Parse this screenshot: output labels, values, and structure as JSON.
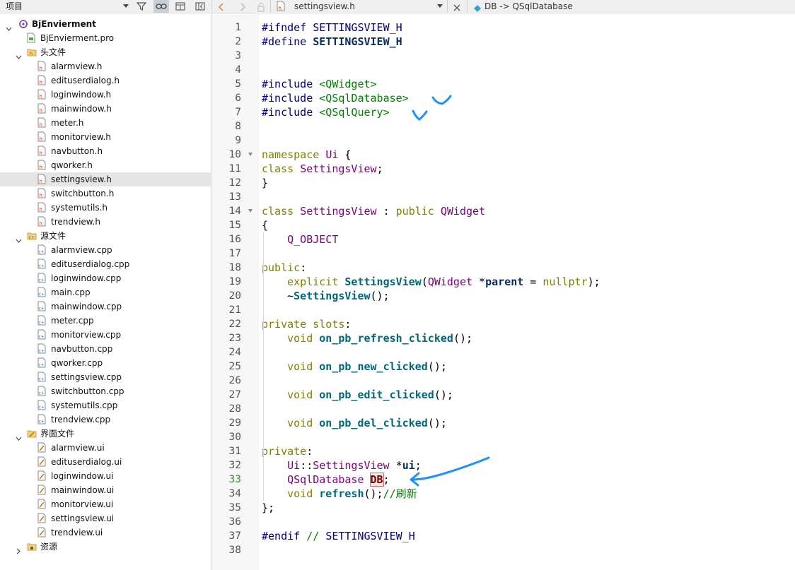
{
  "left_panel": {
    "title": "项目",
    "tree": [
      {
        "label": "BjEnvierment",
        "depth": 0,
        "expanded": true,
        "icon": "qt-project-icon",
        "bold": true
      },
      {
        "label": "BjEnvierment.pro",
        "depth": 1,
        "icon": "pro-file-icon"
      },
      {
        "label": "头文件",
        "depth": 1,
        "expanded": true,
        "icon": "header-folder-icon"
      },
      {
        "label": "alarmview.h",
        "depth": 2,
        "icon": "header-file-icon"
      },
      {
        "label": "edituserdialog.h",
        "depth": 2,
        "icon": "header-file-icon"
      },
      {
        "label": "loginwindow.h",
        "depth": 2,
        "icon": "header-file-icon"
      },
      {
        "label": "mainwindow.h",
        "depth": 2,
        "icon": "header-file-icon"
      },
      {
        "label": "meter.h",
        "depth": 2,
        "icon": "header-file-icon"
      },
      {
        "label": "monitorview.h",
        "depth": 2,
        "icon": "header-file-icon"
      },
      {
        "label": "navbutton.h",
        "depth": 2,
        "icon": "header-file-icon"
      },
      {
        "label": "qworker.h",
        "depth": 2,
        "icon": "header-file-icon"
      },
      {
        "label": "settingsview.h",
        "depth": 2,
        "icon": "header-file-icon",
        "selected": true
      },
      {
        "label": "switchbutton.h",
        "depth": 2,
        "icon": "header-file-icon"
      },
      {
        "label": "systemutils.h",
        "depth": 2,
        "icon": "header-file-icon"
      },
      {
        "label": "trendview.h",
        "depth": 2,
        "icon": "header-file-icon"
      },
      {
        "label": "源文件",
        "depth": 1,
        "expanded": true,
        "icon": "source-folder-icon"
      },
      {
        "label": "alarmview.cpp",
        "depth": 2,
        "icon": "cpp-file-icon"
      },
      {
        "label": "edituserdialog.cpp",
        "depth": 2,
        "icon": "cpp-file-icon"
      },
      {
        "label": "loginwindow.cpp",
        "depth": 2,
        "icon": "cpp-file-icon"
      },
      {
        "label": "main.cpp",
        "depth": 2,
        "icon": "cpp-file-icon"
      },
      {
        "label": "mainwindow.cpp",
        "depth": 2,
        "icon": "cpp-file-icon"
      },
      {
        "label": "meter.cpp",
        "depth": 2,
        "icon": "cpp-file-icon"
      },
      {
        "label": "monitorview.cpp",
        "depth": 2,
        "icon": "cpp-file-icon"
      },
      {
        "label": "navbutton.cpp",
        "depth": 2,
        "icon": "cpp-file-icon"
      },
      {
        "label": "qworker.cpp",
        "depth": 2,
        "icon": "cpp-file-icon"
      },
      {
        "label": "settingsview.cpp",
        "depth": 2,
        "icon": "cpp-file-icon"
      },
      {
        "label": "switchbutton.cpp",
        "depth": 2,
        "icon": "cpp-file-icon"
      },
      {
        "label": "systemutils.cpp",
        "depth": 2,
        "icon": "cpp-file-icon"
      },
      {
        "label": "trendview.cpp",
        "depth": 2,
        "icon": "cpp-file-icon"
      },
      {
        "label": "界面文件",
        "depth": 1,
        "expanded": true,
        "icon": "forms-folder-icon"
      },
      {
        "label": "alarmview.ui",
        "depth": 2,
        "icon": "ui-file-icon"
      },
      {
        "label": "edituserdialog.ui",
        "depth": 2,
        "icon": "ui-file-icon"
      },
      {
        "label": "loginwindow.ui",
        "depth": 2,
        "icon": "ui-file-icon"
      },
      {
        "label": "mainwindow.ui",
        "depth": 2,
        "icon": "ui-file-icon"
      },
      {
        "label": "monitorview.ui",
        "depth": 2,
        "icon": "ui-file-icon"
      },
      {
        "label": "settingsview.ui",
        "depth": 2,
        "icon": "ui-file-icon"
      },
      {
        "label": "trendview.ui",
        "depth": 2,
        "icon": "ui-file-icon"
      },
      {
        "label": "资源",
        "depth": 1,
        "expanded": false,
        "icon": "resources-folder-icon"
      }
    ]
  },
  "editor_toolbar": {
    "file_tab": "settingsview.h",
    "symbol": "DB -> QSqlDatabase"
  },
  "editor": {
    "current_line": 33,
    "fold_lines": [
      10,
      14
    ],
    "lines": [
      [
        [
          "pp",
          "#ifndef "
        ],
        [
          "mac",
          "SETTINGSVIEW_H"
        ]
      ],
      [
        [
          "pp",
          "#define "
        ],
        [
          "idn",
          "SETTINGSVIEW_H"
        ]
      ],
      [],
      [],
      [
        [
          "pp",
          "#include "
        ],
        [
          "inc",
          "<QWidget>"
        ]
      ],
      [
        [
          "pp",
          "#include "
        ],
        [
          "inc",
          "<QSqlDatabase>"
        ]
      ],
      [
        [
          "pp",
          "#include "
        ],
        [
          "inc",
          "<QSqlQuery>"
        ]
      ],
      [],
      [],
      [
        [
          "kw",
          "namespace "
        ],
        [
          "ty",
          "Ui "
        ],
        [
          "",
          "{"
        ]
      ],
      [
        [
          "kw",
          "class "
        ],
        [
          "ty",
          "SettingsView"
        ],
        [
          "",
          ";"
        ]
      ],
      [
        [
          "",
          "}"
        ]
      ],
      [],
      [
        [
          "kw",
          "class "
        ],
        [
          "ty",
          "SettingsView"
        ],
        [
          "",
          " : "
        ],
        [
          "kw",
          "public "
        ],
        [
          "ty",
          "QWidget"
        ]
      ],
      [
        [
          "",
          "{"
        ]
      ],
      [
        [
          "",
          "    "
        ],
        [
          "st",
          "Q_OBJECT"
        ]
      ],
      [],
      [
        [
          "kw",
          "public"
        ],
        [
          "",
          ":"
        ]
      ],
      [
        [
          "",
          "    "
        ],
        [
          "kw",
          "explicit "
        ],
        [
          "fn",
          "SettingsView"
        ],
        [
          "",
          "("
        ],
        [
          "ty",
          "QWidget"
        ],
        [
          "",
          " *"
        ],
        [
          "idn",
          "parent"
        ],
        [
          "",
          " = "
        ],
        [
          "kw",
          "nullptr"
        ],
        [
          "",
          ");"
        ]
      ],
      [
        [
          "",
          "    ~"
        ],
        [
          "fn",
          "SettingsView"
        ],
        [
          "",
          "();"
        ]
      ],
      [],
      [
        [
          "kw",
          "private slots"
        ],
        [
          "",
          ":"
        ]
      ],
      [
        [
          "",
          "    "
        ],
        [
          "kw",
          "void "
        ],
        [
          "fn",
          "on_pb_refresh_clicked"
        ],
        [
          "",
          "();"
        ]
      ],
      [],
      [
        [
          "",
          "    "
        ],
        [
          "kw",
          "void "
        ],
        [
          "fn",
          "on_pb_new_clicked"
        ],
        [
          "",
          "();"
        ]
      ],
      [],
      [
        [
          "",
          "    "
        ],
        [
          "kw",
          "void "
        ],
        [
          "fn",
          "on_pb_edit_clicked"
        ],
        [
          "",
          "();"
        ]
      ],
      [],
      [
        [
          "",
          "    "
        ],
        [
          "kw",
          "void "
        ],
        [
          "fn",
          "on_pb_del_clicked"
        ],
        [
          "",
          "();"
        ]
      ],
      [],
      [
        [
          "kw",
          "private"
        ],
        [
          "",
          ":"
        ]
      ],
      [
        [
          "",
          "    "
        ],
        [
          "ty",
          "Ui"
        ],
        [
          "",
          "::"
        ],
        [
          "ty",
          "SettingsView"
        ],
        [
          "",
          " *"
        ],
        [
          "idn",
          "ui"
        ],
        [
          "",
          ";"
        ]
      ],
      [
        [
          "",
          "    "
        ],
        [
          "ty",
          "QSqlDatabase "
        ],
        [
          "hl",
          "DB"
        ],
        [
          "",
          ";"
        ]
      ],
      [
        [
          "",
          "    "
        ],
        [
          "kw",
          "void "
        ],
        [
          "fn",
          "refresh"
        ],
        [
          "",
          "();"
        ],
        [
          "cm",
          "//刷新"
        ]
      ],
      [
        [
          "",
          "};"
        ]
      ],
      [],
      [
        [
          "pp",
          "#endif "
        ],
        [
          "cm",
          "// "
        ],
        [
          "mac",
          "SETTINGSVIEW_H"
        ]
      ],
      []
    ]
  },
  "colors": {
    "annotation": "#1e90ff",
    "selected_row": "#e5e5e5",
    "gutter": "#f7f7f7"
  }
}
